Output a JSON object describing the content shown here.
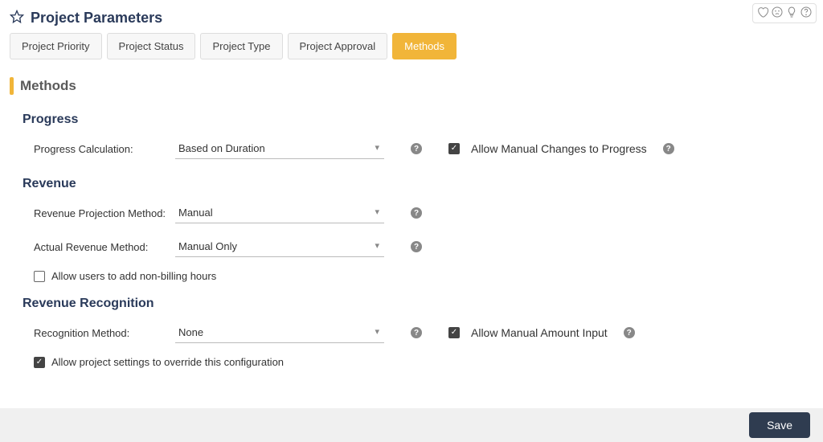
{
  "header": {
    "title": "Project Parameters"
  },
  "tabs": [
    {
      "label": "Project Priority",
      "active": false
    },
    {
      "label": "Project Status",
      "active": false
    },
    {
      "label": "Project Type",
      "active": false
    },
    {
      "label": "Project Approval",
      "active": false
    },
    {
      "label": "Methods",
      "active": true
    }
  ],
  "section_title": "Methods",
  "progress": {
    "title": "Progress",
    "calc_label": "Progress Calculation:",
    "calc_value": "Based on Duration",
    "allow_manual_label": "Allow Manual Changes to Progress",
    "allow_manual_checked": true
  },
  "revenue": {
    "title": "Revenue",
    "projection_label": "Revenue Projection Method:",
    "projection_value": "Manual",
    "actual_label": "Actual Revenue Method:",
    "actual_value": "Manual Only",
    "nonbilling_label": "Allow users to add non-billing hours",
    "nonbilling_checked": false
  },
  "recognition": {
    "title": "Revenue Recognition",
    "method_label": "Recognition Method:",
    "method_value": "None",
    "allow_manual_label": "Allow Manual Amount Input",
    "allow_manual_checked": true,
    "override_label": "Allow project settings to override this configuration",
    "override_checked": true
  },
  "footer": {
    "save_label": "Save"
  }
}
